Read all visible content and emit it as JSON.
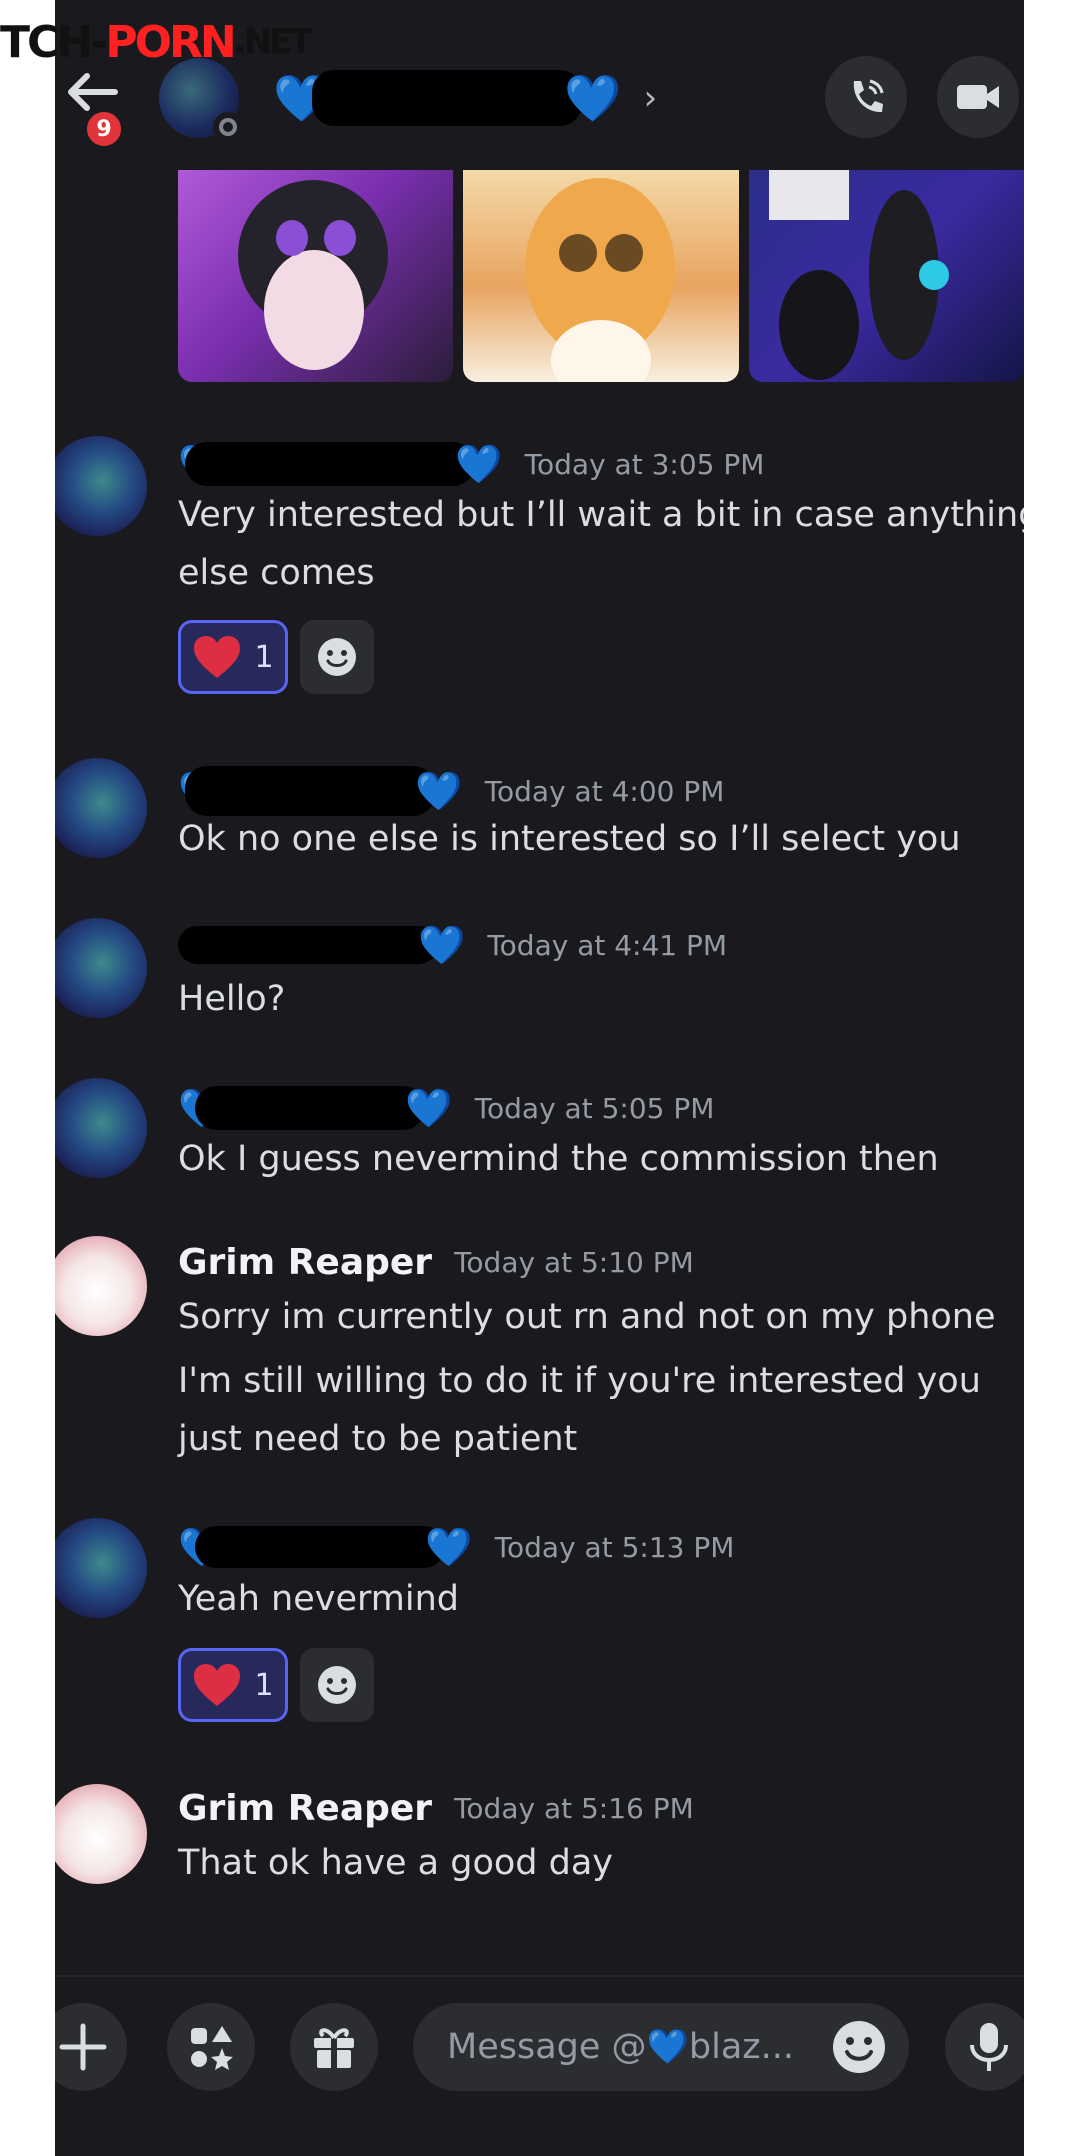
{
  "watermark": {
    "part1": "TCH-",
    "part2": "PORN",
    "part3": ".NET"
  },
  "header": {
    "back_badge": "9",
    "recipient_name_visible": "",
    "chevron": "›"
  },
  "colors": {
    "background": "#1a1a1e",
    "accent": "#5865f2",
    "heart": "#1e88e5",
    "badge": "#e0343a"
  },
  "messages": [
    {
      "author": "",
      "time": "Today at 3:05 PM",
      "lines": [
        "Very interested but I’ll wait a bit in case anything",
        "else comes"
      ],
      "reaction": {
        "emoji": "heart-icon",
        "count": "1"
      }
    },
    {
      "author": "",
      "time": "Today at 4:00 PM",
      "lines": [
        "Ok no one else is interested so I’ll select you"
      ]
    },
    {
      "author": "",
      "time": "Today at 4:41 PM",
      "lines": [
        "Hello?"
      ]
    },
    {
      "author": "",
      "time": "Today at 5:05 PM",
      "lines": [
        "Ok I guess nevermind the commission then"
      ]
    },
    {
      "author": "Grim Reaper",
      "time": "Today at 5:10 PM",
      "lines": [
        "Sorry im currently out rn and not on my phone"
      ],
      "lines2": [
        "I'm still willing to do it if you're interested you",
        "just need to be patient"
      ]
    },
    {
      "author": "",
      "time": "Today at 5:13 PM",
      "lines": [
        "Yeah nevermind"
      ],
      "reaction": {
        "emoji": "heart-icon",
        "count": "1"
      }
    },
    {
      "author": "Grim Reaper",
      "time": "Today at 5:16 PM",
      "lines": [
        "That ok have a good day"
      ]
    }
  ],
  "composer": {
    "placeholder_prefix": "Message @",
    "placeholder_suffix": "blaz..."
  }
}
